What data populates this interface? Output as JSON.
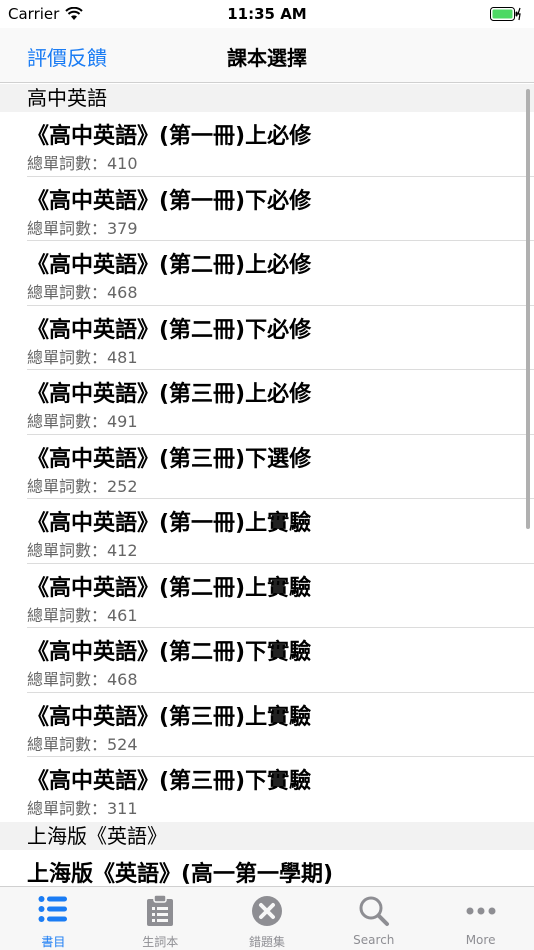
{
  "status_bar": {
    "carrier": "Carrier",
    "time": "11:35 AM"
  },
  "nav": {
    "left_button": "評價反饋",
    "title": "課本選擇"
  },
  "sections": [
    {
      "header": "高中英語",
      "rows": [
        {
          "title": "《高中英語》(第一冊)上必修",
          "subtitle": "總單詞數：410"
        },
        {
          "title": "《高中英語》(第一冊)下必修",
          "subtitle": "總單詞數：379"
        },
        {
          "title": "《高中英語》(第二冊)上必修",
          "subtitle": "總單詞數：468"
        },
        {
          "title": "《高中英語》(第二冊)下必修",
          "subtitle": "總單詞數：481"
        },
        {
          "title": "《高中英語》(第三冊)上必修",
          "subtitle": "總單詞數：491"
        },
        {
          "title": "《高中英語》(第三冊)下選修",
          "subtitle": "總單詞數：252"
        },
        {
          "title": "《高中英語》(第一冊)上實驗",
          "subtitle": "總單詞數：412"
        },
        {
          "title": "《高中英語》(第二冊)上實驗",
          "subtitle": "總單詞數：461"
        },
        {
          "title": "《高中英語》(第二冊)下實驗",
          "subtitle": "總單詞數：468"
        },
        {
          "title": "《高中英語》(第三冊)上實驗",
          "subtitle": "總單詞數：524"
        },
        {
          "title": "《高中英語》(第三冊)下實驗",
          "subtitle": "總單詞數：311"
        }
      ]
    },
    {
      "header": "上海版《英語》",
      "rows": [
        {
          "title": "上海版《英語》(高一第一學期)",
          "subtitle": ""
        }
      ]
    }
  ],
  "tabs": [
    {
      "label": "書目",
      "icon": "list-icon",
      "active": true
    },
    {
      "label": "生詞本",
      "icon": "clipboard-icon",
      "active": false
    },
    {
      "label": "錯題集",
      "icon": "x-circle-icon",
      "active": false
    },
    {
      "label": "Search",
      "icon": "search-icon",
      "active": false
    },
    {
      "label": "More",
      "icon": "more-icon",
      "active": false
    }
  ],
  "colors": {
    "accent": "#1a7cf4",
    "inactive": "#8e8e93"
  }
}
